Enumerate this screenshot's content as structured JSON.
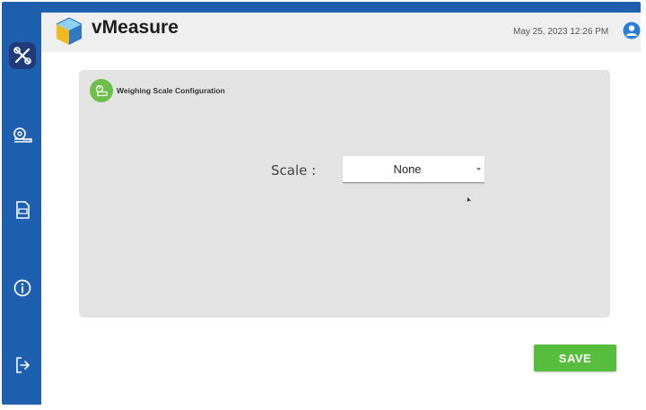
{
  "header": {
    "brand": "vMeasure",
    "datetime": "May 25, 2023 12:26 PM"
  },
  "sidebar": {
    "items": [
      {
        "icon": "tools-icon",
        "active": true
      },
      {
        "icon": "measuring-tape-icon",
        "active": false
      },
      {
        "icon": "document-icon",
        "active": false
      },
      {
        "icon": "info-icon",
        "active": false
      },
      {
        "icon": "logout-icon",
        "active": false
      }
    ]
  },
  "panel": {
    "title": "Weighing Scale Configuration",
    "icon": "weighing-scale-icon",
    "scale_label": "Scale :",
    "scale_value": "None"
  },
  "actions": {
    "save_label": "SAVE"
  },
  "colors": {
    "frame": "#1f5fb0",
    "active_nav": "#203a7a",
    "accent_green": "#57bd3c",
    "panel_bg": "#e3e3e3",
    "header_bg": "#efefef",
    "user_icon": "#2a7fd4"
  }
}
